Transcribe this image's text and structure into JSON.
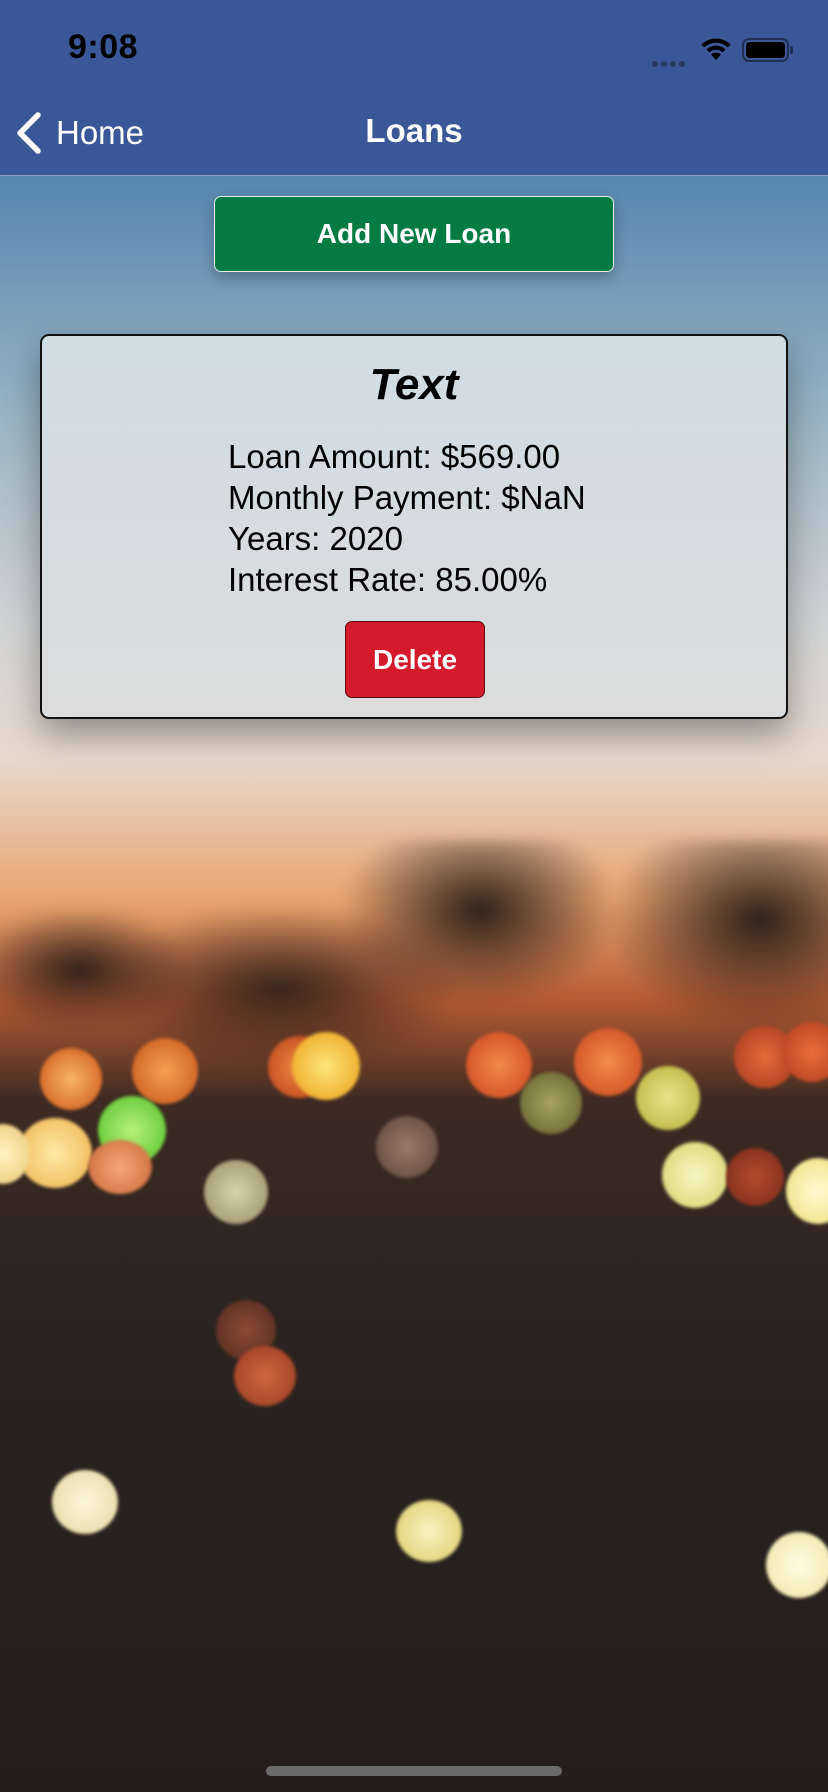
{
  "status_bar": {
    "time": "9:08"
  },
  "nav": {
    "back_label": "Home",
    "title": "Loans"
  },
  "actions": {
    "add_loan_label": "Add New Loan"
  },
  "loan": {
    "title": "Text",
    "amount_text": "Loan Amount: $569.00",
    "monthly_payment_text": "Monthly Payment: $NaN",
    "years_text": "Years: 2020",
    "interest_rate_text": "Interest Rate: 85.00%",
    "delete_label": "Delete"
  },
  "colors": {
    "nav_background": "#3a5797",
    "add_button": "#047b43",
    "delete_button": "#d41b2c",
    "card_background": "#d6dcdf"
  },
  "icons": {
    "back": "chevron-left-icon",
    "wifi": "wifi-icon",
    "battery": "battery-icon",
    "signal": "signal-dots-icon"
  }
}
